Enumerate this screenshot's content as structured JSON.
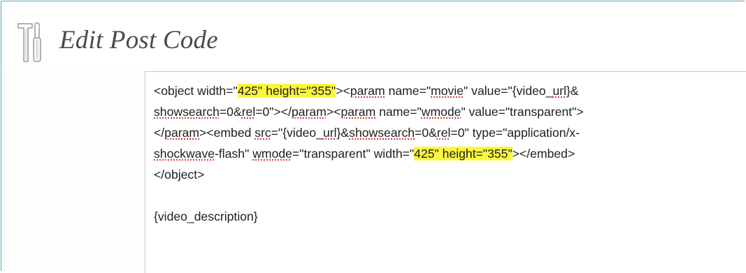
{
  "header": {
    "title": "Edit Post Code",
    "icon": "tools-icon"
  },
  "editor": {
    "lines": [
      [
        {
          "t": "<object width=\""
        },
        {
          "t": "425\" height=\"355\"",
          "hl": true
        },
        {
          "t": "><"
        },
        {
          "t": "param",
          "sp": true
        },
        {
          "t": " name=\""
        },
        {
          "t": "movie",
          "sp": true
        },
        {
          "t": "\" value=\"{video_"
        },
        {
          "t": "url",
          "sp": true
        },
        {
          "t": "}&"
        }
      ],
      [
        {
          "t": "showsearch",
          "sp": true
        },
        {
          "t": "=0&"
        },
        {
          "t": "rel",
          "sp": true
        },
        {
          "t": "=0\"></"
        },
        {
          "t": "param",
          "sp": true
        },
        {
          "t": "><"
        },
        {
          "t": "param",
          "sp": true
        },
        {
          "t": " name=\""
        },
        {
          "t": "wmode",
          "sp": true
        },
        {
          "t": "\" value=\"transparent\">"
        }
      ],
      [
        {
          "t": "</"
        },
        {
          "t": "param",
          "sp": true
        },
        {
          "t": "><embed "
        },
        {
          "t": "src",
          "sp": true
        },
        {
          "t": "=\"{video_"
        },
        {
          "t": "url",
          "sp": true
        },
        {
          "t": "}&"
        },
        {
          "t": "showsearch",
          "sp": true
        },
        {
          "t": "=0&"
        },
        {
          "t": "rel",
          "sp": true
        },
        {
          "t": "=0\" type=\"application/x-"
        }
      ],
      [
        {
          "t": "shockwave",
          "sp": true
        },
        {
          "t": "-flash\" "
        },
        {
          "t": "wmode",
          "sp": true
        },
        {
          "t": "=\"transparent\" width=\""
        },
        {
          "t": "425\" height=\"355\"",
          "hl": true
        },
        {
          "t": "></embed>"
        }
      ],
      [
        {
          "t": "</object>"
        }
      ],
      [],
      [
        {
          "t": "{video_description}"
        }
      ]
    ]
  },
  "colors": {
    "highlight": "#fbf73f",
    "frame_border": "#5fa3b8",
    "spell_underline": "#d02020"
  }
}
